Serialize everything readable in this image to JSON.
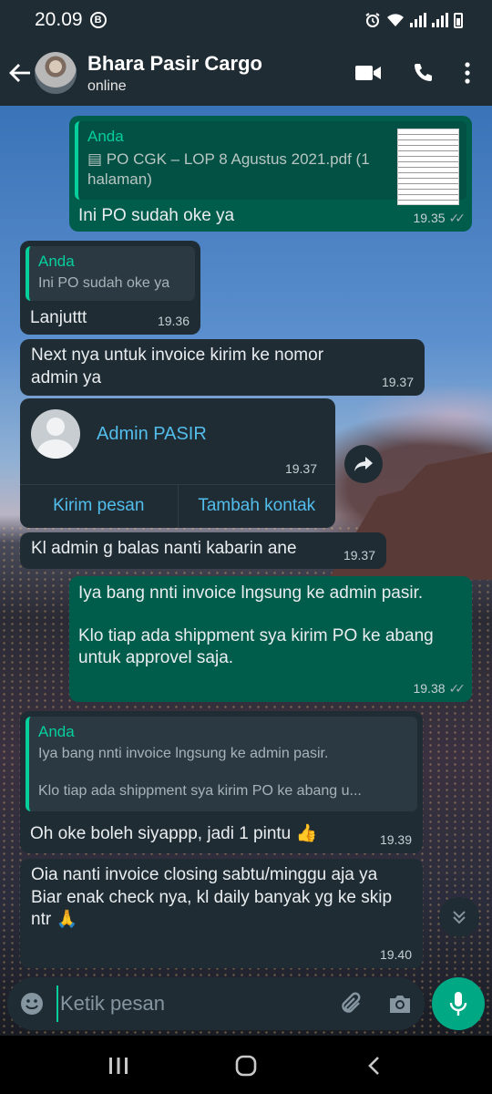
{
  "status_bar": {
    "time": "20.09",
    "b_badge": "B"
  },
  "header": {
    "contact_name": "Bhara Pasir Cargo",
    "status": "online"
  },
  "messages": {
    "m1": {
      "quote_author": "Anda",
      "doc_name": "PO CGK – LOP 8 Agustus 2021.pdf (1 halaman)",
      "text": "Ini PO sudah oke ya",
      "time": "19.35"
    },
    "m2": {
      "quote_author": "Anda",
      "quote_text": "Ini PO sudah oke ya",
      "text": "Lanjuttt",
      "time": "19.36"
    },
    "m3": {
      "text": "Next nya untuk invoice kirim ke nomor admin ya",
      "time": "19.37"
    },
    "m4": {
      "contact_name": "Admin PASIR",
      "time": "19.37",
      "action_message": "Kirim pesan",
      "action_add": "Tambah kontak"
    },
    "m5": {
      "text": "Kl admin g balas nanti kabarin ane",
      "time": "19.37"
    },
    "m6": {
      "line1": "Iya bang nnti invoice lngsung ke admin pasir.",
      "line2": "Klo tiap ada shippment sya kirim PO ke abang untuk approvel saja.",
      "time": "19.38"
    },
    "m7": {
      "quote_author": "Anda",
      "quote_line1": "Iya bang nnti invoice lngsung ke admin pasir.",
      "quote_line2": "Klo tiap ada shippment sya kirim PO ke abang u...",
      "text": "Oh oke boleh siyappp, jadi 1 pintu 👍",
      "time": "19.39"
    },
    "m8": {
      "line1": "Oia nanti invoice closing sabtu/minggu aja ya",
      "line2": "Biar enak check nya, kl daily banyak yg ke skip ntr 🙏",
      "time": "19.40"
    }
  },
  "input": {
    "placeholder": "Ketik pesan"
  },
  "colors": {
    "outgoing": "#005c4b",
    "incoming": "#1f2c34",
    "accent": "#00a884"
  }
}
